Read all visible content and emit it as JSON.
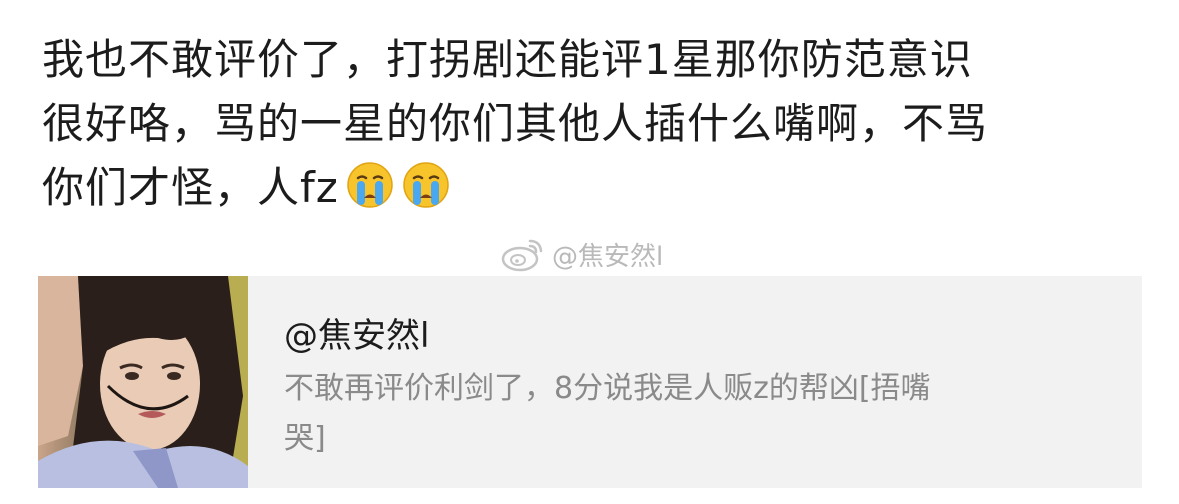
{
  "post": {
    "lines": [
      "我也不敢评价了，打拐剧还能评1星那你防范意识",
      "很好咯，骂的一星的你们其他人插什么嘴啊，不骂",
      "你们才怪，人fz"
    ],
    "emojis": [
      "crying-face-icon",
      "crying-face-icon"
    ]
  },
  "watermark": {
    "text": "@焦安然l",
    "icon": "weibo-logo-icon"
  },
  "quote": {
    "username": "@焦安然l",
    "lines": [
      "不敢再评价利剑了，8分说我是人贩z的帮凶[捂嘴",
      "哭]"
    ],
    "thumbnail": "person-photo"
  },
  "colors": {
    "text_primary": "#1c1c1c",
    "text_secondary": "#8a8a8a",
    "card_bg": "#f2f2f2",
    "watermark": "#b9b9b9"
  }
}
